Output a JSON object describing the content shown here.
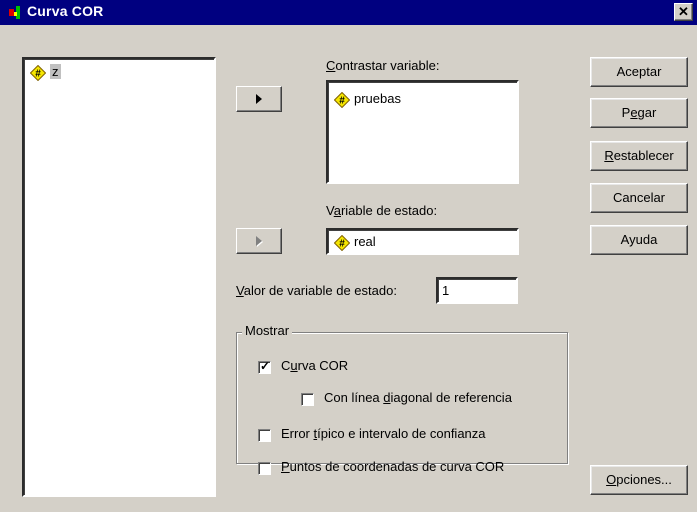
{
  "window": {
    "title": "Curva COR",
    "close_glyph": "✕"
  },
  "source_list": {
    "items": [
      {
        "name": "z",
        "icon": "scale-variable-icon"
      }
    ]
  },
  "test_variable": {
    "label_underlined": "C",
    "label_rest": "ontrastar variable:",
    "items": [
      {
        "name": "pruebas",
        "icon": "scale-variable-icon"
      }
    ]
  },
  "state_variable": {
    "label_pre": "V",
    "label_underlined": "a",
    "label_rest": "riable de estado:",
    "value": "real",
    "icon": "scale-variable-icon"
  },
  "state_value": {
    "label_underlined": "V",
    "label_rest": "alor de variable de estado:",
    "value": "1"
  },
  "display_group": {
    "legend": "Mostrar",
    "options": [
      {
        "key": "roc_curve",
        "pre": "C",
        "underlined": "u",
        "post": "rva COR",
        "checked": true
      },
      {
        "key": "diagonal",
        "pre": "Con línea ",
        "underlined": "d",
        "post": "iagonal de referencia",
        "checked": false
      },
      {
        "key": "std_error",
        "pre": "Error ",
        "underlined": "t",
        "post": "ípico e intervalo de confianza",
        "checked": false
      },
      {
        "key": "coord_points",
        "pre": "",
        "underlined": "P",
        "post": "untos de coordenadas de curva COR",
        "checked": false
      }
    ]
  },
  "buttons": {
    "ok": {
      "pre": "Aceptar",
      "underlined": "",
      "post": ""
    },
    "paste": {
      "pre": "P",
      "underlined": "e",
      "post": "gar"
    },
    "reset": {
      "pre": "",
      "underlined": "R",
      "post": "establecer"
    },
    "cancel": {
      "pre": "Cancelar",
      "underlined": "",
      "post": ""
    },
    "help": {
      "pre": "Ayuda",
      "underlined": "",
      "post": ""
    },
    "options": {
      "pre": "",
      "underlined": "O",
      "post": "pciones..."
    }
  },
  "colors": {
    "titlebar": "#000080",
    "face": "#d4d0c8",
    "icon_yellow": "#f5e600"
  }
}
